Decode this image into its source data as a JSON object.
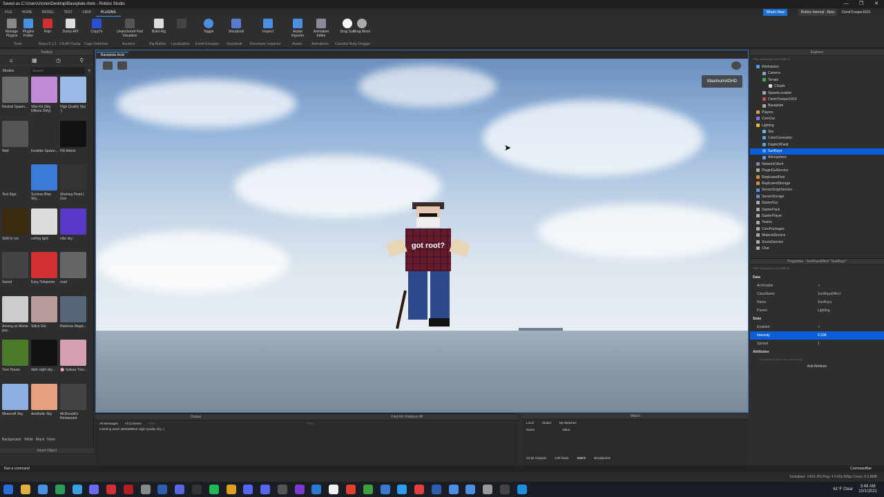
{
  "window": {
    "title": "Saved as C:\\Users\\ztonie\\Desktop\\Baseplate.rbxlx - Roblox Studio",
    "controls": [
      "—",
      "❐",
      "✕"
    ]
  },
  "menu": [
    "FILE",
    "HOME",
    "MODEL",
    "TEST",
    "VIEW",
    "PLUGINS"
  ],
  "header": {
    "whats_new": "What's New",
    "internal": "Roblox Internal - Beta",
    "user": "CloneTrooper1019"
  },
  "ribbon": {
    "buttons": [
      "Manage Plugins",
      "Plugins Folder",
      "Rojo",
      "Dump API",
      "CopyTo",
      "Unanchored Part Visualizer",
      "Build Rig",
      "",
      "Toggle",
      "Storybook",
      "Inspect",
      "Avatar Importer",
      "Animation Editor",
      "Drag Sun",
      "Drag Moon"
    ],
    "groups": [
      "Tools",
      "Roact 0.1.2",
      "CA API Dump",
      "Cage Deformer",
      "Anchors",
      "Rig Builder",
      "Localization",
      "Event Emulator",
      "Storybook",
      "Developer Inspector",
      "Avatar",
      "Animations",
      "Celestial Body Dragger"
    ]
  },
  "toolbox": {
    "title": "Toolbox",
    "category": "Models",
    "search_placeholder": "Search",
    "items": [
      {
        "label": "Neutral Spawn...",
        "color": "#6b6b6b"
      },
      {
        "label": "Vibe Kit (Sky Effects Only)",
        "color": "#c28ad6"
      },
      {
        "label": "High Quality Sky :)",
        "color": "#9bb9e6"
      },
      {
        "label": "Wall",
        "color": "#555555"
      },
      {
        "label": "Invisible Spawn...",
        "color": "#2e2e2e"
      },
      {
        "label": "HD Admin",
        "color": "#111111"
      },
      {
        "label": "Text Sign",
        "color": "#2e2e2e"
      },
      {
        "label": "Sunless Blue Sky...",
        "color": "#3b7bd8"
      },
      {
        "label": "Working Pistol | Gun",
        "color": "#333333"
      },
      {
        "label": "Shift to run",
        "color": "#3a2a10"
      },
      {
        "label": "ceiling light",
        "color": "#dddddd"
      },
      {
        "label": "vibe sky",
        "color": "#5a39c8"
      },
      {
        "label": "Sword",
        "color": "#444444"
      },
      {
        "label": "Easy Teleporter",
        "color": "#d03030"
      },
      {
        "label": "road",
        "color": "#666666"
      },
      {
        "label": "Among us Meme guy...",
        "color": "#cccccc"
      },
      {
        "label": "Stitch Girl",
        "color": "#b89a9a"
      },
      {
        "label": "Rainbow Magic...",
        "color": "#556677"
      },
      {
        "label": "Tree House",
        "color": "#4a7a2a"
      },
      {
        "label": "dark night sky...",
        "color": "#111111"
      },
      {
        "label": "🌸 Sakura Tree...",
        "color": "#d7a0b0"
      },
      {
        "label": "Minecraft Sky",
        "color": "#8bb0e0"
      },
      {
        "label": "Aesthetic Sky",
        "color": "#e8a080"
      },
      {
        "label": "McDonald's Restaurant",
        "color": "#444444"
      }
    ],
    "background_label": "Background:",
    "backgrounds": [
      "White",
      "Black",
      "None"
    ],
    "insert_object": "Insert Object"
  },
  "viewport": {
    "tab": "Baseplate.rbxlx",
    "badge": "MaximumADHD",
    "shirt_text": "got root?"
  },
  "explorer": {
    "title": "Explorer",
    "filter_placeholder": "Filter workspace (Ctrl+Shift+X)",
    "items": [
      {
        "label": "Workspace",
        "indent": 1,
        "color": "#4ca3e0"
      },
      {
        "label": "Camera",
        "indent": 2,
        "color": "#8aa0b8"
      },
      {
        "label": "Terrain",
        "indent": 2,
        "color": "#3fae5a"
      },
      {
        "label": "Clouds",
        "indent": 3,
        "color": "#dddddd"
      },
      {
        "label": "SpawnLocation",
        "indent": 2,
        "color": "#aaaaaa"
      },
      {
        "label": "CloneTrooper1019",
        "indent": 2,
        "color": "#c35050"
      },
      {
        "label": "Baseplate",
        "indent": 2,
        "color": "#aaaaaa"
      },
      {
        "label": "Players",
        "indent": 1,
        "color": "#d0a040"
      },
      {
        "label": "CoreGui",
        "indent": 1,
        "color": "#7a7aee"
      },
      {
        "label": "Lighting",
        "indent": 1,
        "color": "#e0c040"
      },
      {
        "label": "Sky",
        "indent": 2,
        "color": "#7aaee0"
      },
      {
        "label": "ColorCorrection",
        "indent": 2,
        "color": "#5aa0e0"
      },
      {
        "label": "DepthOfField",
        "indent": 2,
        "color": "#5aa0e0"
      },
      {
        "label": "SunRays",
        "indent": 2,
        "color": "#5aa0e0",
        "selected": true
      },
      {
        "label": "Atmosphere",
        "indent": 2,
        "color": "#5aa0e0"
      },
      {
        "label": "NetworkClient",
        "indent": 1,
        "color": "#8888aa"
      },
      {
        "label": "PluginGuiService",
        "indent": 1,
        "color": "#aaaaaa"
      },
      {
        "label": "ReplicatedFirst",
        "indent": 1,
        "color": "#d09040"
      },
      {
        "label": "ReplicatedStorage",
        "indent": 1,
        "color": "#d09040"
      },
      {
        "label": "ServerScriptService",
        "indent": 1,
        "color": "#5a90d0"
      },
      {
        "label": "ServerStorage",
        "indent": 1,
        "color": "#5a90d0"
      },
      {
        "label": "StarterGui",
        "indent": 1,
        "color": "#aaaaaa"
      },
      {
        "label": "StarterPack",
        "indent": 1,
        "color": "#aaaaaa"
      },
      {
        "label": "StarterPlayer",
        "indent": 1,
        "color": "#aaaaaa"
      },
      {
        "label": "Teams",
        "indent": 1,
        "color": "#aaaaaa"
      },
      {
        "label": "CorePackages",
        "indent": 1,
        "color": "#aaaaaa"
      },
      {
        "label": "MaterialService",
        "indent": 1,
        "color": "#aaaaaa"
      },
      {
        "label": "SoundService",
        "indent": 1,
        "color": "#aaaaaa"
      },
      {
        "label": "Chat",
        "indent": 1,
        "color": "#aaaaaa"
      }
    ]
  },
  "properties": {
    "title": "Properties - SunRaysEffect \"SunRays\"",
    "filter_placeholder": "Filter Properties (Ctrl+Shift+P)",
    "sections": [
      {
        "name": "Data",
        "rows": [
          {
            "k": "Archivable",
            "v": "✓"
          },
          {
            "k": "ClassName",
            "v": "SunRaysEffect"
          },
          {
            "k": "Name",
            "v": "SunRays"
          },
          {
            "k": "Parent",
            "v": "Lighting"
          }
        ]
      },
      {
        "name": "State",
        "rows": [
          {
            "k": "Enabled",
            "v": "✓"
          },
          {
            "k": "Intensity",
            "v": "0.338",
            "selected": true
          },
          {
            "k": "Spread",
            "v": "1"
          }
        ]
      },
      {
        "name": "Attributes",
        "rows": []
      }
    ],
    "attributes_note": "No attributes have been added yet.",
    "add_attribute": "Add Attribute"
  },
  "output": {
    "title": "Output",
    "filter_messages": "All Messages",
    "filter_contexts": "All Contexts",
    "filter_placeholder": "Filter...",
    "line": "Inserting asset 4802599810 High Quality Sky :)"
  },
  "find": {
    "title": "Find All / Replace All",
    "placeholder": "Find..."
  },
  "watch": {
    "title": "Watch",
    "tabs": [
      "Local",
      "Global",
      "My Watches"
    ],
    "columns": [
      "Name",
      "Value"
    ],
    "bottom_tabs": [
      "Script Analysis",
      "Call Stack",
      "Watch",
      "Breakpoints"
    ]
  },
  "command": {
    "placeholder": "Run a command",
    "label": "CommandBar"
  },
  "status": "Scheduler: 143/1.0%   Ping: 4   0.00s    60fps   Cores: 8   3.8MB",
  "taskbar": {
    "icons": [
      "#2a6fd6",
      "#e0b040",
      "#4a8fe0",
      "#2d9b5a",
      "#3aa0e0",
      "#6a6af0",
      "#d03030",
      "#b02020",
      "#888888",
      "#2d5fae",
      "#5a66e0",
      "#333333",
      "#1db954",
      "#e0a020",
      "#5865f2",
      "#5865f2",
      "#555555",
      "#7a3ad0",
      "#2a7ad0",
      "#f0f0f0",
      "#e04030",
      "#40a040",
      "#3a7ad0",
      "#2d9bf0",
      "#e04040",
      "#2d5fae",
      "#4a8fe0",
      "#4a8fe0",
      "#999999",
      "#444444",
      "#1a8fe0"
    ],
    "weather": "61°F Clear",
    "time": "3:48 AM",
    "date": "10/1/2021"
  }
}
